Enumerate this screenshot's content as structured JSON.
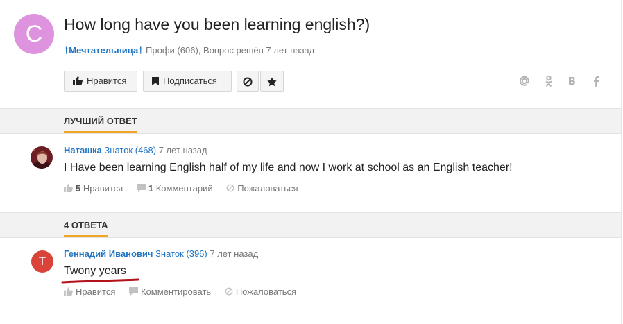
{
  "question": {
    "avatar_letter": "С",
    "title": "How long have you been learning english?)",
    "author": "†Мечтательница†",
    "author_info": "Профи (606), Вопрос решён 7 лет назад"
  },
  "toolbar": {
    "like_label": "Нравится",
    "subscribe_label": "Подписаться"
  },
  "share_icons": [
    "at-icon",
    "odnoklassniki-icon",
    "vk-icon",
    "facebook-icon"
  ],
  "best_answer": {
    "section_label": "ЛУЧШИЙ ОТВЕТ",
    "author": "Наташка",
    "rank": "Знаток (468)",
    "time": "7 лет назад",
    "text": "I Have been learning English half of my life and now I work at school as an English teacher!",
    "likes_count": "5",
    "likes_label": "Нравится",
    "comments_count": "1",
    "comments_label": "Комментарий",
    "report_label": "Пожаловаться"
  },
  "answers_section": {
    "label": "4 ОТВЕТА"
  },
  "answers": [
    {
      "avatar_letter": "Т",
      "author": "Геннадий Иванович",
      "rank": "Знаток (396)",
      "time": "7 лет назад",
      "text": "Twony years",
      "like_label": "Нравится",
      "comment_label": "Комментировать",
      "report_label": "Пожаловаться"
    }
  ],
  "colors": {
    "accent_blue": "#1f75c4",
    "question_avatar": "#dd93dd",
    "answer_avatar": "#d9433a",
    "tab_underline": "#f0a624",
    "annotation_red": "#b3121b"
  }
}
